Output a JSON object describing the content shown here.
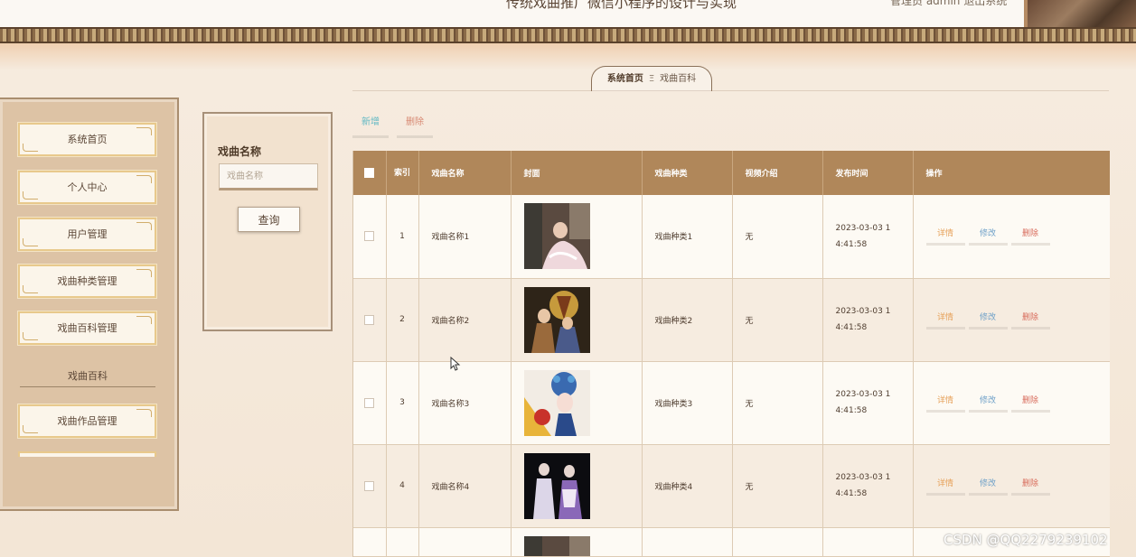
{
  "header": {
    "title": "传统戏曲推广微信小程序的设计与实现",
    "user_text": "管理员 admin 退出系统"
  },
  "breadcrumb": {
    "home": "系统首页",
    "separator": "Ξ",
    "current": "戏曲百科"
  },
  "sidebar": {
    "items": [
      {
        "label": "系统首页"
      },
      {
        "label": "个人中心"
      },
      {
        "label": "用户管理"
      },
      {
        "label": "戏曲种类管理"
      },
      {
        "label": "戏曲百科管理"
      }
    ],
    "section_label": "戏曲百科",
    "section_items": [
      {
        "label": "戏曲作品管理"
      }
    ]
  },
  "search": {
    "label": "戏曲名称",
    "placeholder": "戏曲名称",
    "button": "查询"
  },
  "toolbar": {
    "add": "新增",
    "delete": "删除"
  },
  "table": {
    "headers": {
      "index": "索引",
      "name": "戏曲名称",
      "cover": "封面",
      "type": "戏曲种类",
      "intro": "视频介绍",
      "time": "发布时间",
      "ops": "操作"
    },
    "actions": {
      "detail": "详情",
      "edit": "修改",
      "remove": "删除"
    },
    "rows": [
      {
        "index": "1",
        "name": "戏曲名称1",
        "type": "戏曲种类1",
        "intro": "无",
        "time_line1": "2023-03-03 1",
        "time_line2": "4:41:58",
        "cover_icon": "opera-performer-photo"
      },
      {
        "index": "2",
        "name": "戏曲名称2",
        "type": "戏曲种类2",
        "intro": "无",
        "time_line1": "2023-03-03 1",
        "time_line2": "4:41:58",
        "cover_icon": "opera-poster-photo"
      },
      {
        "index": "3",
        "name": "戏曲名称3",
        "type": "戏曲种类3",
        "intro": "无",
        "time_line1": "2023-03-03 1",
        "time_line2": "4:41:58",
        "cover_icon": "opera-headdress-photo"
      },
      {
        "index": "4",
        "name": "戏曲名称4",
        "type": "戏曲种类4",
        "intro": "无",
        "time_line1": "2023-03-03 1",
        "time_line2": "4:41:58",
        "cover_icon": "opera-duet-photo"
      }
    ]
  },
  "watermark": "CSDN @QQ2279239102",
  "colors": {
    "header_bg": "#b0875a",
    "detail": "#e6a058",
    "edit": "#6ea0c8",
    "remove": "#d86b5b",
    "add": "#62b8c4"
  }
}
